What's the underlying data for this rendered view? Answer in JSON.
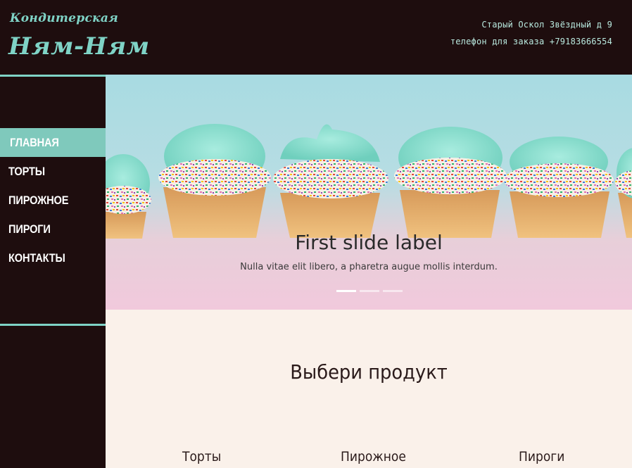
{
  "header": {
    "logo_top": "Кондитерская",
    "logo_main": "Ням-Ням",
    "address": "Старый Оскол Звёздный д 9",
    "phone": "телефон для заказа +79183666554"
  },
  "menu": {
    "items": [
      {
        "label": "ГЛАВНАЯ",
        "active": true
      },
      {
        "label": "ТОРТЫ"
      },
      {
        "label": "ПИРОЖНОЕ"
      },
      {
        "label": "ПИРОГИ"
      },
      {
        "label": "КОНТАКТЫ"
      }
    ]
  },
  "carousel": {
    "title": "First slide label",
    "text": "Nulla vitae elit libero, a pharetra augue mollis interdum.",
    "active_index": 0,
    "slide_count": 3
  },
  "products": {
    "title": "Выбери продукт",
    "items": [
      "Торты",
      "Пирожное",
      "Пироги"
    ]
  },
  "colors": {
    "dark": "#1e0d0e",
    "accent": "#7fd3c6",
    "page_bg": "#faf1ea"
  }
}
